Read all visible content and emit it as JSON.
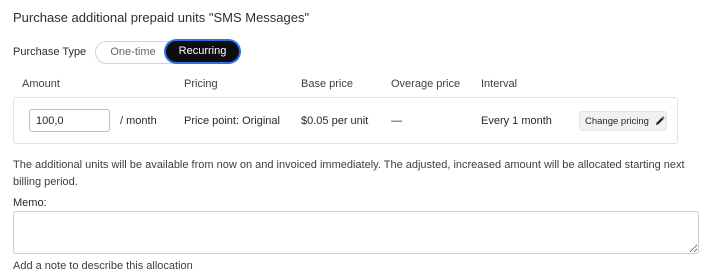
{
  "title": "Purchase additional prepaid units \"SMS Messages\"",
  "purchase_type": {
    "label": "Purchase Type",
    "options": [
      "One-time",
      "Recurring"
    ],
    "selected": "Recurring"
  },
  "table": {
    "headers": [
      "Amount",
      "Pricing",
      "Base price",
      "Overage price",
      "Interval"
    ],
    "row": {
      "amount_value": "100,0",
      "per_unit": "/ month",
      "pricing": "Price point: Original",
      "base_price": "$0.05 per unit",
      "overage_price": "—",
      "interval": "Every 1 month",
      "change_button": "Change pricing"
    }
  },
  "info_text": "The additional units will be available from now on and invoiced immediately. The adjusted, increased amount will be allocated starting next billing period.",
  "memo": {
    "label": "Memo:",
    "value": "",
    "help": "Add a note to describe this allocation"
  },
  "icons": {
    "change_pricing": "pencil-icon"
  },
  "colors": {
    "selected_bg": "#0b0d0f",
    "selected_ring": "#2f6fe0"
  }
}
